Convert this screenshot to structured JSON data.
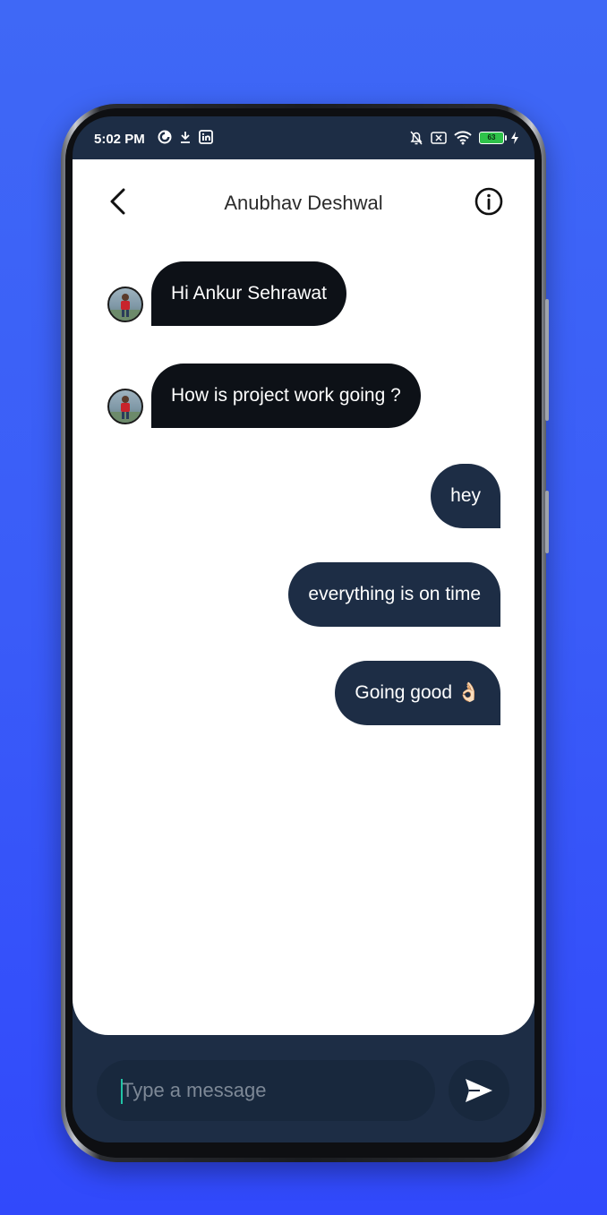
{
  "status_bar": {
    "time": "5:02 PM",
    "battery_level": "63",
    "left_icons": [
      "data-saver-icon",
      "download-icon",
      "linkedin-icon"
    ],
    "right_icons": [
      "mute-bell-icon",
      "sim-off-icon",
      "wifi-icon",
      "battery-icon",
      "charging-icon"
    ]
  },
  "header": {
    "title": "Anubhav Deshwal",
    "back_icon": "chevron-left-icon",
    "info_icon": "info-icon"
  },
  "messages": [
    {
      "direction": "incoming",
      "text": "Hi Ankur Sehrawat"
    },
    {
      "direction": "incoming",
      "text": "How is project work going ?"
    },
    {
      "direction": "outgoing",
      "text": "hey"
    },
    {
      "direction": "outgoing",
      "text": "everything is on time"
    },
    {
      "direction": "outgoing",
      "text": "Going good 👌🏻"
    }
  ],
  "composer": {
    "placeholder": "Type a message",
    "value": "",
    "send_icon": "send-icon"
  },
  "colors": {
    "background": "#3a5cf8",
    "theme": "#1d2d45",
    "incoming_bubble": "#0d1117",
    "outgoing_bubble": "#1d2d45",
    "caret": "#21c4a6"
  }
}
